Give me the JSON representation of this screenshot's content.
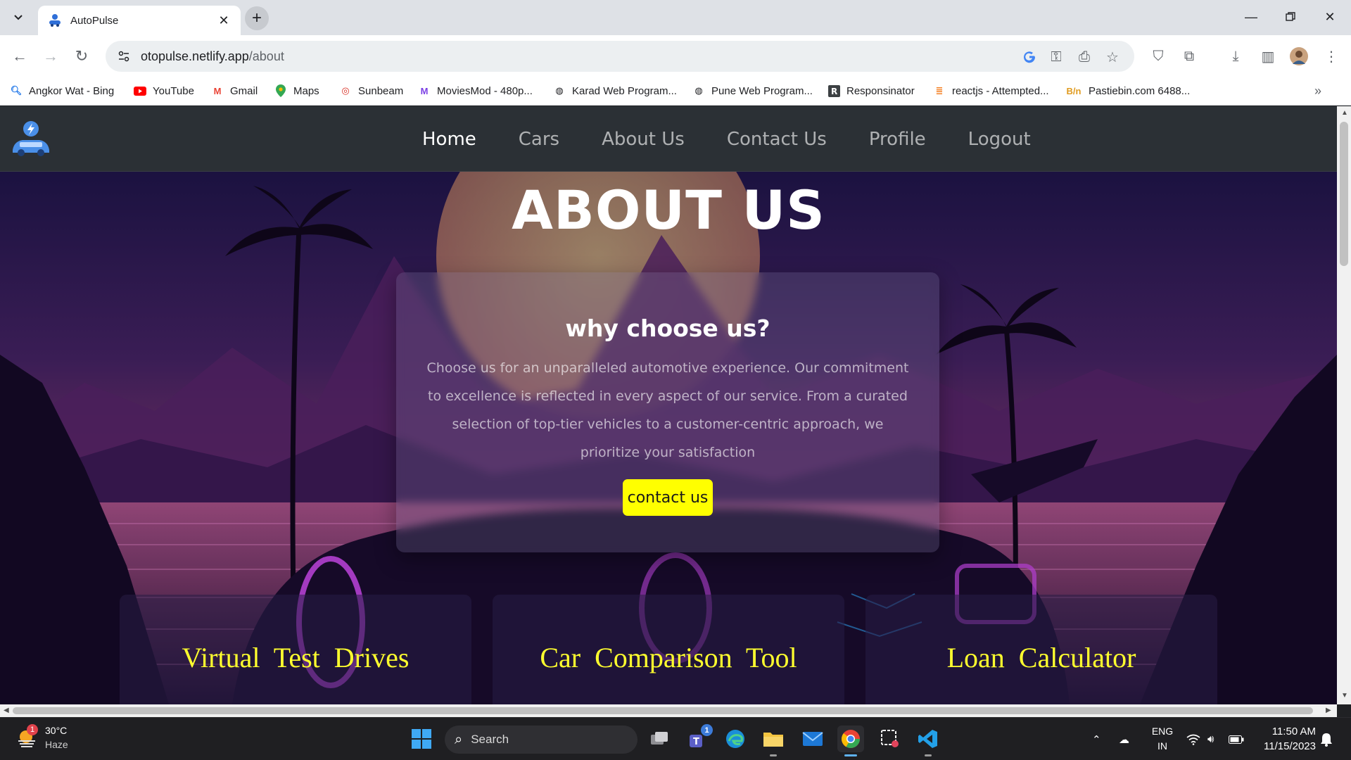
{
  "browser": {
    "tab_title": "AutoPulse",
    "url_host": "otopulse.netlify.app",
    "url_path": "/about",
    "bookmarks": [
      {
        "label": "Angkor Wat - Bing",
        "icon": "bing-search-icon"
      },
      {
        "label": "YouTube",
        "icon": "youtube-icon"
      },
      {
        "label": "Gmail",
        "icon": "gmail-icon"
      },
      {
        "label": "Maps",
        "icon": "maps-pin-icon"
      },
      {
        "label": "Sunbeam",
        "icon": "sunbeam-icon"
      },
      {
        "label": "MoviesMod - 480p...",
        "icon": "moviesmod-icon"
      },
      {
        "label": "Karad Web Program...",
        "icon": "globe-icon"
      },
      {
        "label": "Pune Web Program...",
        "icon": "globe-icon"
      },
      {
        "label": "Responsinator",
        "icon": "responsinator-icon"
      },
      {
        "label": "reactjs - Attempted...",
        "icon": "stackoverflow-icon"
      },
      {
        "label": "Pastiebin.com 6488...",
        "icon": "pastebin-icon"
      }
    ]
  },
  "site": {
    "nav": [
      "Home",
      "Cars",
      "About Us",
      "Contact Us",
      "Profile",
      "Logout"
    ],
    "active_nav": "Home",
    "title": "ABOUT US",
    "card": {
      "heading": "why choose us?",
      "body": "Choose us for an unparalleled automotive experience. Our commitment to excellence is reflected in every aspect of our service. From a curated selection of top-tier vehicles to a customer-centric approach, we prioritize your satisfaction",
      "button": "contact us"
    },
    "features": [
      "Virtual Test Drives",
      "Car Comparison Tool",
      "Loan Calculator"
    ],
    "colors": {
      "accent": "#ffff00",
      "feature_text": "#ffff2e",
      "navbar": "#2b3035"
    }
  },
  "taskbar": {
    "weather_temp": "30°C",
    "weather_cond": "Haze",
    "weather_badge": "1",
    "search_label": "Search",
    "teams_badge": "1",
    "lang_1": "ENG",
    "lang_2": "IN",
    "time": "11:50 AM",
    "date": "11/15/2023"
  }
}
